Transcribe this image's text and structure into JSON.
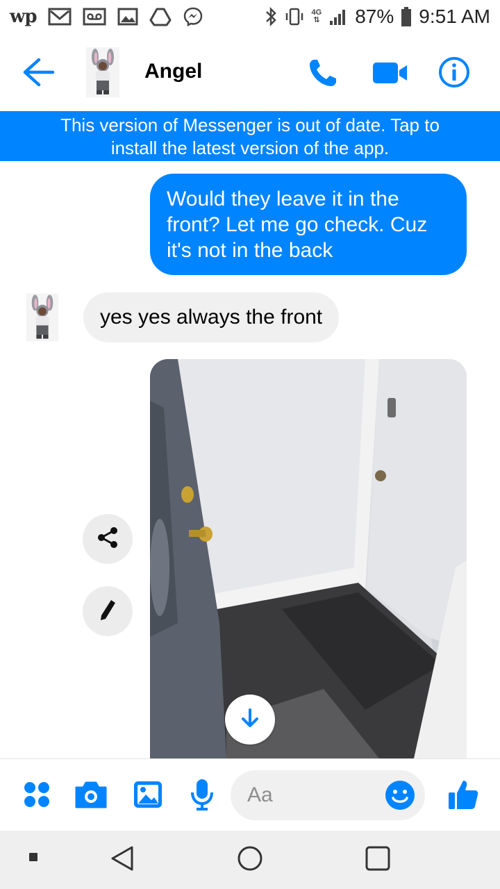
{
  "status_bar": {
    "left_icons": [
      "washington-post-icon",
      "gmail-icon",
      "voicemail-icon",
      "gallery-icon",
      "drive-icon",
      "messenger-icon"
    ],
    "wp_text": "wp",
    "right_icons": [
      "bluetooth-icon",
      "vibrate-icon",
      "lte-icon",
      "signal-icon"
    ],
    "network_label": "4G",
    "battery": "87%",
    "time": "9:51 AM"
  },
  "header": {
    "contact_name": "Angel",
    "actions": [
      "phone-icon",
      "video-icon",
      "info-icon"
    ]
  },
  "banner": {
    "line1": "This version of Messenger is out of date. Tap to",
    "line2": "install the latest version of the app."
  },
  "messages": [
    {
      "direction": "outgoing",
      "lines": [
        "Would they leave it in the",
        "front? Let me go check. Cuz",
        "it's not in the back"
      ]
    },
    {
      "direction": "incoming",
      "text": "yes yes always the front"
    },
    {
      "direction": "outgoing",
      "type": "photo",
      "description": "doorway-photo"
    }
  ],
  "photo_actions": [
    "share-icon",
    "pencil-icon",
    "download-icon"
  ],
  "composer": {
    "placeholder": "Aa",
    "icons": [
      "menu-dots-icon",
      "camera-icon",
      "image-icon",
      "microphone-icon",
      "emoji-icon",
      "thumbs-up-icon"
    ]
  },
  "colors": {
    "accent": "#0084ff",
    "incoming_bubble": "#f1f0f0",
    "nav_bar": "#efefef"
  }
}
